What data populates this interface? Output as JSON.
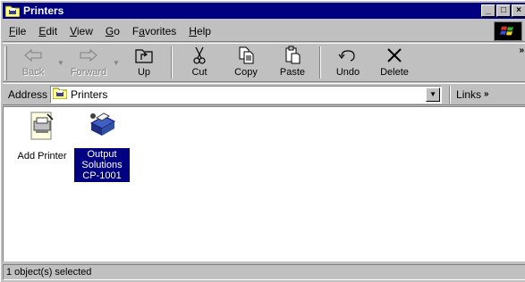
{
  "window": {
    "title": "Printers"
  },
  "menu": [
    {
      "label": "File",
      "accel": "F",
      "rest": "ile"
    },
    {
      "label": "Edit",
      "accel": "E",
      "rest": "dit"
    },
    {
      "label": "View",
      "accel": "V",
      "rest": "iew"
    },
    {
      "label": "Go",
      "accel": "G",
      "rest": "o"
    },
    {
      "label": "Favorites",
      "accel": "a",
      "pre": "F",
      "rest": "vorites"
    },
    {
      "label": "Help",
      "accel": "H",
      "rest": "elp"
    }
  ],
  "toolbar": {
    "back": "Back",
    "forward": "Forward",
    "up": "Up",
    "cut": "Cut",
    "copy": "Copy",
    "paste": "Paste",
    "undo": "Undo",
    "delete": "Delete"
  },
  "address": {
    "label": "Address",
    "value": "Printers",
    "links": "Links"
  },
  "items": [
    {
      "label": "Add Printer",
      "icon": "add-printer-icon",
      "selected": false
    },
    {
      "label": "Output Solutions CP-1001",
      "icon": "printer-icon",
      "selected": true
    }
  ],
  "status": {
    "text": "1 object(s) selected"
  },
  "colors": {
    "title_bar": "#000080",
    "face": "#c0c0c0",
    "selection": "#000080"
  }
}
